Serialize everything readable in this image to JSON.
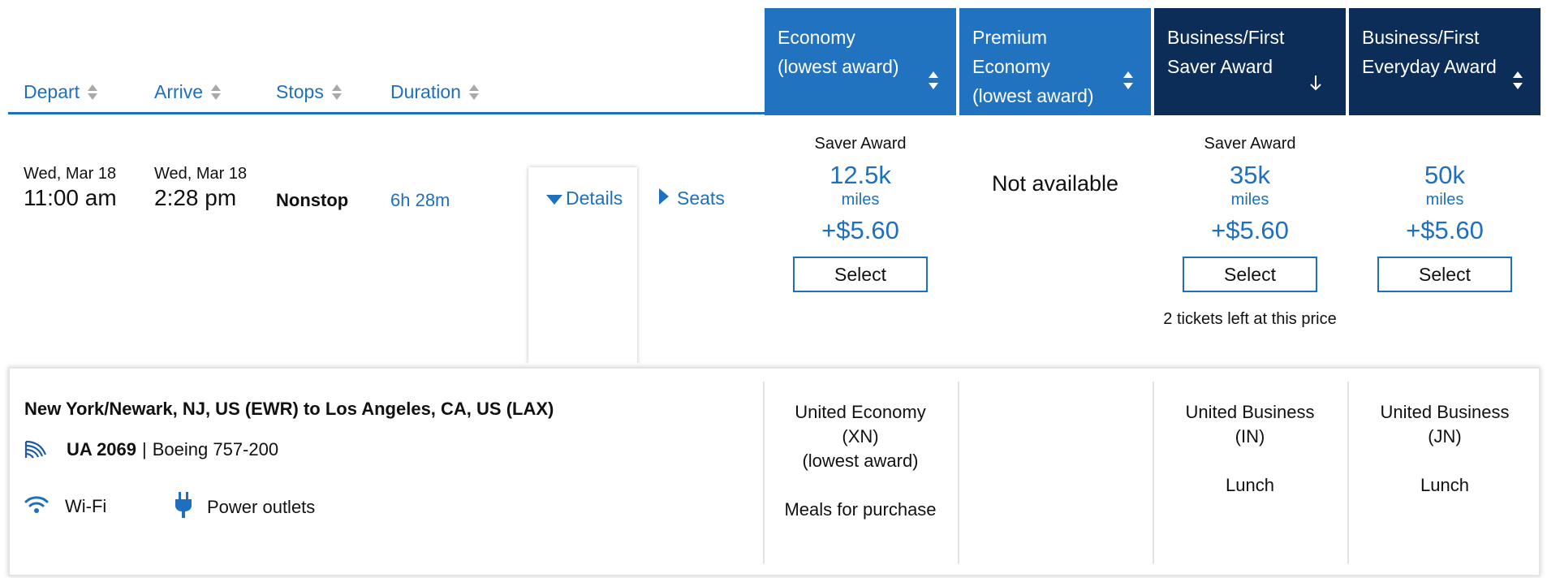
{
  "sort_headers": [
    {
      "label": "Depart"
    },
    {
      "label": "Arrive"
    },
    {
      "label": "Stops"
    },
    {
      "label": "Duration"
    }
  ],
  "fare_columns": [
    {
      "title": "Economy\n(lowest award)",
      "sort_icon": "sort-both-icon"
    },
    {
      "title": "Premium\nEconomy\n(lowest award)",
      "sort_icon": "sort-both-icon"
    },
    {
      "title": "Business/First\nSaver Award",
      "sort_icon": "arrow-down-icon"
    },
    {
      "title": "Business/First\nEveryday Award",
      "sort_icon": "sort-both-icon"
    }
  ],
  "flight": {
    "depart_date": "Wed, Mar 18",
    "depart_time": "11:00 am",
    "arrive_date": "Wed, Mar 18",
    "arrive_time": "2:28 pm",
    "stops": "Nonstop",
    "duration": "6h 28m",
    "details_label": "Details",
    "seats_label": "Seats"
  },
  "fares": [
    {
      "award_type": "Saver Award",
      "miles": "12.5k",
      "miles_word": "miles",
      "tax": "+$5.60",
      "select_label": "Select",
      "note": ""
    },
    {
      "unavailable": "Not available"
    },
    {
      "award_type": "Saver Award",
      "miles": "35k",
      "miles_word": "miles",
      "tax": "+$5.60",
      "select_label": "Select",
      "note": "2 tickets left at this price"
    },
    {
      "award_type": "",
      "miles": "50k",
      "miles_word": "miles",
      "tax": "+$5.60",
      "select_label": "Select",
      "note": ""
    }
  ],
  "details": {
    "route": "New York/Newark, NJ, US (EWR) to Los Angeles, CA, US (LAX)",
    "flight_number": "UA 2069",
    "separator": "|",
    "aircraft": "Boeing 757-200",
    "amenities": [
      {
        "label": "Wi-Fi",
        "icon": "wifi-icon"
      },
      {
        "label": "Power outlets",
        "icon": "power-plug-icon"
      }
    ],
    "cabins": [
      "United Economy\n(XN)\n(lowest award)\n\nMeals for purchase",
      "",
      "United Business\n(IN)\n\nLunch",
      "United Business\n(JN)\n\nLunch"
    ]
  },
  "colors": {
    "accent": "#2172bf",
    "navy": "#0b2d57",
    "link": "#1f6fbf"
  }
}
